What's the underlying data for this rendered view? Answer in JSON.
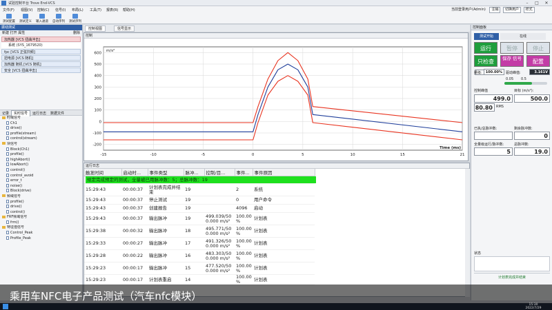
{
  "app": {
    "title": "试验控制平台 Trove End-VCS"
  },
  "menu": [
    "文件(F)",
    "视图(V)",
    "控制(C)",
    "信号(I)",
    "布局(L)",
    "工具(T)",
    "报表(R)",
    "帮助(H)"
  ],
  "user": {
    "prefix": "当前登录用户(Admin)",
    "b1": "注销",
    "b2": "切换用户",
    "b3": "样式"
  },
  "toolbar": [
    {
      "label": "测试配置"
    },
    {
      "label": "测试定义"
    },
    {
      "label": "输入通道"
    },
    {
      "label": "自动序列"
    },
    {
      "label": "测试序列"
    }
  ],
  "left": {
    "header": "振动测试",
    "toolbar": [
      "新建",
      "打开",
      "属性",
      "删除"
    ],
    "controllers": [
      {
        "label": "加热器 [VCS 扭曲冲击]",
        "selected": true
      },
      {
        "label": "系统 (SYS_1679520)",
        "selected": false
      },
      {
        "label": "fpc [VCS 正弦扫频]",
        "selected": false
      },
      {
        "label": "扭电源 [VCS 随机]",
        "selected": false
      },
      {
        "label": "加热器 随机 [VCS 随机]",
        "selected": false
      },
      {
        "label": "安全 [VCS 扭曲冲击]",
        "selected": false
      }
    ],
    "tabs": [
      "记录",
      "实时信号",
      "运行日志",
      "数据文件"
    ],
    "tree": [
      {
        "label": "时域信号",
        "level": 0,
        "type": "folder"
      },
      {
        "label": "Ch1",
        "level": 1,
        "type": "doc"
      },
      {
        "label": "drive()",
        "level": 1,
        "type": "doc"
      },
      {
        "label": "profile(stream)",
        "level": 1,
        "type": "doc"
      },
      {
        "label": "control(stream)",
        "level": 1,
        "type": "doc"
      },
      {
        "label": "块信号",
        "level": 0,
        "type": "folder"
      },
      {
        "label": "Block(Ch1)",
        "level": 1,
        "type": "doc"
      },
      {
        "label": "profile()",
        "level": 1,
        "type": "doc"
      },
      {
        "label": "highAbort()",
        "level": 1,
        "type": "doc"
      },
      {
        "label": "lowAbort()",
        "level": 1,
        "type": "doc"
      },
      {
        "label": "control()",
        "level": 1,
        "type": "doc"
      },
      {
        "label": "control_avoid",
        "level": 1,
        "type": "doc"
      },
      {
        "label": "error_t",
        "level": 1,
        "type": "doc"
      },
      {
        "label": "noise()",
        "level": 1,
        "type": "doc"
      },
      {
        "label": "Block(drive)",
        "level": 1,
        "type": "doc"
      },
      {
        "label": "频域信号",
        "level": 0,
        "type": "folder"
      },
      {
        "label": "profile()",
        "level": 1,
        "type": "doc"
      },
      {
        "label": "drive()",
        "level": 1,
        "type": "doc"
      },
      {
        "label": "control()",
        "level": 1,
        "type": "doc"
      },
      {
        "label": "FRF频域信号",
        "level": 0,
        "type": "folder"
      },
      {
        "label": "frm()",
        "level": 1,
        "type": "doc"
      },
      {
        "label": "特征值信号",
        "level": 0,
        "type": "folder"
      },
      {
        "label": "Control_Peak",
        "level": 1,
        "type": "doc"
      },
      {
        "label": "Profile_Peak",
        "level": 1,
        "type": "doc"
      }
    ]
  },
  "center_tabs": [
    "控制视图",
    "信号显示"
  ],
  "chart_title": "控制",
  "chart_data": {
    "type": "line",
    "title": "",
    "ylabel": "m/s²",
    "xlabel": "Time (ms)",
    "xlim": [
      -15,
      21
    ],
    "ylim": [
      -250,
      650
    ],
    "xticks": [
      -15,
      -10,
      -5,
      0,
      5,
      10,
      15,
      21
    ],
    "yticks": [
      -200,
      -100,
      0,
      100,
      200,
      300,
      400,
      500,
      600
    ],
    "grid": true,
    "series": [
      {
        "color": "#e8321e",
        "x": [
          -15,
          0,
          0.5,
          1.5,
          2.5,
          3.5,
          4.5,
          5.5,
          6,
          21
        ],
        "y": [
          -10,
          -10,
          130,
          370,
          530,
          600,
          530,
          370,
          130,
          -10
        ]
      },
      {
        "color": "#1f3e9a",
        "x": [
          -15,
          0,
          0.5,
          1.5,
          2.5,
          3.5,
          4.5,
          5.5,
          6,
          21
        ],
        "y": [
          -90,
          -90,
          60,
          300,
          450,
          500,
          450,
          300,
          60,
          -90
        ]
      },
      {
        "color": "#e8321e",
        "x": [
          -15,
          0,
          0.5,
          1.5,
          2.5,
          3.5,
          4.5,
          5.5,
          6,
          21
        ],
        "y": [
          -160,
          -160,
          -10,
          230,
          350,
          400,
          350,
          230,
          -10,
          -160
        ]
      }
    ]
  },
  "log": {
    "tab": "运行日志",
    "columns": [
      "触发时间",
      "启动时...",
      "事件类型",
      "脉冲...",
      "控制/目...",
      "事件...",
      "事件原因"
    ],
    "highlight": "规定完成预定的测试，全量被已用脉冲数：5；总脉冲数：19",
    "rows": [
      {
        "time": "15:29:43",
        "elapsed": "00:00:37",
        "type": "计划表完成并结束",
        "pulse": "19",
        "ctrl": "",
        "event": "2",
        "reason": "系统"
      },
      {
        "time": "15:29:43",
        "elapsed": "00:00:37",
        "type": "停止测试",
        "pulse": "19",
        "ctrl": "",
        "event": "0",
        "reason": "用户命令"
      },
      {
        "time": "15:29:43",
        "elapsed": "00:00:37",
        "type": "创建报告",
        "pulse": "19",
        "ctrl": "",
        "event": "4096",
        "reason": "启动"
      },
      {
        "time": "15:29:43",
        "elapsed": "00:00:37",
        "type": "输出脉冲",
        "pulse": "19",
        "ctrl": "499.039/50 0.000 m/s²",
        "event": "100.00 %",
        "reason": "计划表"
      },
      {
        "time": "15:29:38",
        "elapsed": "00:00:32",
        "type": "输出脉冲",
        "pulse": "18",
        "ctrl": "495.771/50 0.000 m/s²",
        "event": "100.00 %",
        "reason": "计划表"
      },
      {
        "time": "15:29:33",
        "elapsed": "00:00:27",
        "type": "输出脉冲",
        "pulse": "17",
        "ctrl": "491.326/50 0.000 m/s²",
        "event": "100.00 %",
        "reason": "计划表"
      },
      {
        "time": "15:29:28",
        "elapsed": "00:00:22",
        "type": "输出脉冲",
        "pulse": "16",
        "ctrl": "483.303/50 0.000 m/s²",
        "event": "100.00 %",
        "reason": "计划表"
      },
      {
        "time": "15:29:23",
        "elapsed": "00:00:17",
        "type": "输出脉冲",
        "pulse": "15",
        "ctrl": "477.520/50 0.000 m/s²",
        "event": "100.00 %",
        "reason": "计划表"
      },
      {
        "time": "15:29:23",
        "elapsed": "00:00:17",
        "type": "计划表重启",
        "pulse": "14",
        "ctrl": "",
        "event": "100.00 %",
        "reason": "计划表"
      }
    ]
  },
  "right": {
    "header": "控制面板",
    "seg": [
      "测试开始",
      "在线"
    ],
    "btn_run": "运行",
    "btn_pause": "暂停",
    "btn_stop": "停止",
    "btn_check": "只检查",
    "btn_save": "保存 信号",
    "btn_config": "配置",
    "level_label": "量级:",
    "level_value": "100.00%",
    "drive_label": "驱动峰值:",
    "drive_value": "3.161V",
    "slider_low": "0.05",
    "slider_high": "0.5",
    "ctrl_peak_label": "控制峰值",
    "target_label": "目标 (m/s²):",
    "ctrl_peak_value": "499.0",
    "target_value": "500.0",
    "rms_value": "80.80",
    "rms_label": "RMS",
    "done_total_label": "已执/总脉冲数:",
    "remain_label": "剩余脉冲数:",
    "remain_value": "0",
    "full_label": "全量级运行/脉冲数:",
    "full_value": "5",
    "total_label": "总脉冲数:",
    "total_value": "19.0",
    "status_label": "状态",
    "status_bar": "计划表完成并结束"
  },
  "caption": "乘用车NFC电子产品测试（汽车nfc模块）",
  "taskbar": {
    "time": "15:30",
    "date": "2022/7/29"
  }
}
